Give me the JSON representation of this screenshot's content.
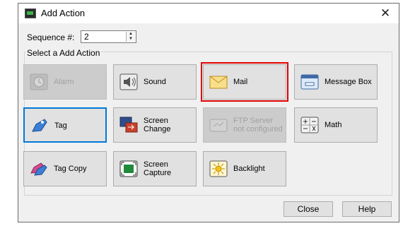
{
  "window": {
    "title": "Add Action",
    "close_glyph": "✕"
  },
  "sequence": {
    "label": "Sequence #:",
    "value": "2"
  },
  "group_label": "Select a Add Action",
  "actions": [
    {
      "label": "Alarm",
      "icon": "alarm-icon",
      "enabled": false
    },
    {
      "label": "Sound",
      "icon": "speaker-icon",
      "enabled": true
    },
    {
      "label": "Mail",
      "icon": "mail-icon",
      "enabled": true,
      "selected": true
    },
    {
      "label": "Message Box",
      "icon": "message-box-icon",
      "enabled": true
    },
    {
      "label": "Tag",
      "icon": "tag-icon",
      "enabled": true,
      "focused": true
    },
    {
      "label": "Screen\nChange",
      "icon": "screen-change-icon",
      "enabled": true
    },
    {
      "label": "FTP Server\nnot configured",
      "icon": "ftp-icon",
      "enabled": false
    },
    {
      "label": "Math",
      "icon": "math-icon",
      "enabled": true
    },
    {
      "label": "Tag Copy",
      "icon": "tag-copy-icon",
      "enabled": true
    },
    {
      "label": "Screen\nCapture",
      "icon": "screen-capture-icon",
      "enabled": true
    },
    {
      "label": "Backlight",
      "icon": "backlight-icon",
      "enabled": true
    }
  ],
  "footer": {
    "close_label": "Close",
    "help_label": "Help"
  },
  "colors": {
    "selection_outline": "#e00000",
    "focus_border": "#0078d7"
  }
}
